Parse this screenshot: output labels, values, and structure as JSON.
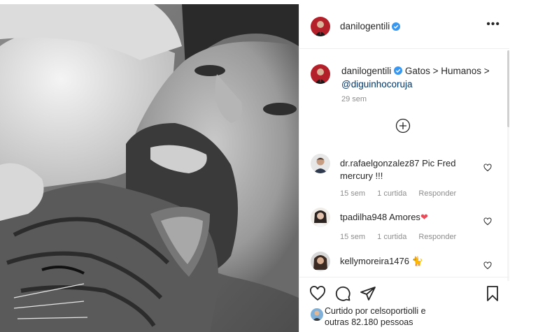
{
  "post": {
    "author": "danilogentili",
    "verified": true,
    "more_icon": "more-dots-icon",
    "caption": {
      "username": "danilogentili",
      "text": "Gatos > Humanos >",
      "mention": "@diguinhocoruja",
      "time": "29 sem"
    }
  },
  "load_more_icon": "plus-circle-icon",
  "comments": [
    {
      "username": "dr.rafaelgonzalez87",
      "text": "Pic Fred mercury !!!",
      "time": "15 sem",
      "likes": "1 curtida",
      "reply": "Responder"
    },
    {
      "username": "tpadilha948",
      "text": "Amores",
      "emoji": "❤",
      "time": "15 sem",
      "likes": "1 curtida",
      "reply": "Responder"
    },
    {
      "username": "kellymoreira1476",
      "emoji": "🐈",
      "text": ""
    }
  ],
  "actions": {
    "liked_prefix": "Curtido por",
    "liked_user": "celsoportiolli",
    "liked_suffix": "e",
    "others": "outras 82.180 pessoas"
  },
  "colors": {
    "verified": "#3897f0",
    "emoji_heart": "#ed4956",
    "secondary": "#8e8e8e",
    "mention": "#00376b"
  }
}
